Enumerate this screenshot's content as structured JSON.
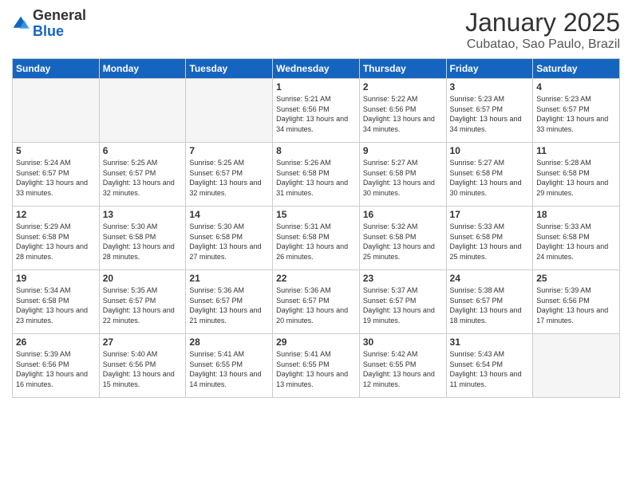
{
  "header": {
    "logo_general": "General",
    "logo_blue": "Blue",
    "month": "January 2025",
    "location": "Cubatao, Sao Paulo, Brazil"
  },
  "days_of_week": [
    "Sunday",
    "Monday",
    "Tuesday",
    "Wednesday",
    "Thursday",
    "Friday",
    "Saturday"
  ],
  "weeks": [
    [
      {
        "day": "",
        "sunrise": "",
        "sunset": "",
        "daylight": "",
        "empty": true
      },
      {
        "day": "",
        "sunrise": "",
        "sunset": "",
        "daylight": "",
        "empty": true
      },
      {
        "day": "",
        "sunrise": "",
        "sunset": "",
        "daylight": "",
        "empty": true
      },
      {
        "day": "1",
        "sunrise": "Sunrise: 5:21 AM",
        "sunset": "Sunset: 6:56 PM",
        "daylight": "Daylight: 13 hours and 34 minutes."
      },
      {
        "day": "2",
        "sunrise": "Sunrise: 5:22 AM",
        "sunset": "Sunset: 6:56 PM",
        "daylight": "Daylight: 13 hours and 34 minutes."
      },
      {
        "day": "3",
        "sunrise": "Sunrise: 5:23 AM",
        "sunset": "Sunset: 6:57 PM",
        "daylight": "Daylight: 13 hours and 34 minutes."
      },
      {
        "day": "4",
        "sunrise": "Sunrise: 5:23 AM",
        "sunset": "Sunset: 6:57 PM",
        "daylight": "Daylight: 13 hours and 33 minutes."
      }
    ],
    [
      {
        "day": "5",
        "sunrise": "Sunrise: 5:24 AM",
        "sunset": "Sunset: 6:57 PM",
        "daylight": "Daylight: 13 hours and 33 minutes."
      },
      {
        "day": "6",
        "sunrise": "Sunrise: 5:25 AM",
        "sunset": "Sunset: 6:57 PM",
        "daylight": "Daylight: 13 hours and 32 minutes."
      },
      {
        "day": "7",
        "sunrise": "Sunrise: 5:25 AM",
        "sunset": "Sunset: 6:57 PM",
        "daylight": "Daylight: 13 hours and 32 minutes."
      },
      {
        "day": "8",
        "sunrise": "Sunrise: 5:26 AM",
        "sunset": "Sunset: 6:58 PM",
        "daylight": "Daylight: 13 hours and 31 minutes."
      },
      {
        "day": "9",
        "sunrise": "Sunrise: 5:27 AM",
        "sunset": "Sunset: 6:58 PM",
        "daylight": "Daylight: 13 hours and 30 minutes."
      },
      {
        "day": "10",
        "sunrise": "Sunrise: 5:27 AM",
        "sunset": "Sunset: 6:58 PM",
        "daylight": "Daylight: 13 hours and 30 minutes."
      },
      {
        "day": "11",
        "sunrise": "Sunrise: 5:28 AM",
        "sunset": "Sunset: 6:58 PM",
        "daylight": "Daylight: 13 hours and 29 minutes."
      }
    ],
    [
      {
        "day": "12",
        "sunrise": "Sunrise: 5:29 AM",
        "sunset": "Sunset: 6:58 PM",
        "daylight": "Daylight: 13 hours and 28 minutes."
      },
      {
        "day": "13",
        "sunrise": "Sunrise: 5:30 AM",
        "sunset": "Sunset: 6:58 PM",
        "daylight": "Daylight: 13 hours and 28 minutes."
      },
      {
        "day": "14",
        "sunrise": "Sunrise: 5:30 AM",
        "sunset": "Sunset: 6:58 PM",
        "daylight": "Daylight: 13 hours and 27 minutes."
      },
      {
        "day": "15",
        "sunrise": "Sunrise: 5:31 AM",
        "sunset": "Sunset: 6:58 PM",
        "daylight": "Daylight: 13 hours and 26 minutes."
      },
      {
        "day": "16",
        "sunrise": "Sunrise: 5:32 AM",
        "sunset": "Sunset: 6:58 PM",
        "daylight": "Daylight: 13 hours and 25 minutes."
      },
      {
        "day": "17",
        "sunrise": "Sunrise: 5:33 AM",
        "sunset": "Sunset: 6:58 PM",
        "daylight": "Daylight: 13 hours and 25 minutes."
      },
      {
        "day": "18",
        "sunrise": "Sunrise: 5:33 AM",
        "sunset": "Sunset: 6:58 PM",
        "daylight": "Daylight: 13 hours and 24 minutes."
      }
    ],
    [
      {
        "day": "19",
        "sunrise": "Sunrise: 5:34 AM",
        "sunset": "Sunset: 6:58 PM",
        "daylight": "Daylight: 13 hours and 23 minutes."
      },
      {
        "day": "20",
        "sunrise": "Sunrise: 5:35 AM",
        "sunset": "Sunset: 6:57 PM",
        "daylight": "Daylight: 13 hours and 22 minutes."
      },
      {
        "day": "21",
        "sunrise": "Sunrise: 5:36 AM",
        "sunset": "Sunset: 6:57 PM",
        "daylight": "Daylight: 13 hours and 21 minutes."
      },
      {
        "day": "22",
        "sunrise": "Sunrise: 5:36 AM",
        "sunset": "Sunset: 6:57 PM",
        "daylight": "Daylight: 13 hours and 20 minutes."
      },
      {
        "day": "23",
        "sunrise": "Sunrise: 5:37 AM",
        "sunset": "Sunset: 6:57 PM",
        "daylight": "Daylight: 13 hours and 19 minutes."
      },
      {
        "day": "24",
        "sunrise": "Sunrise: 5:38 AM",
        "sunset": "Sunset: 6:57 PM",
        "daylight": "Daylight: 13 hours and 18 minutes."
      },
      {
        "day": "25",
        "sunrise": "Sunrise: 5:39 AM",
        "sunset": "Sunset: 6:56 PM",
        "daylight": "Daylight: 13 hours and 17 minutes."
      }
    ],
    [
      {
        "day": "26",
        "sunrise": "Sunrise: 5:39 AM",
        "sunset": "Sunset: 6:56 PM",
        "daylight": "Daylight: 13 hours and 16 minutes."
      },
      {
        "day": "27",
        "sunrise": "Sunrise: 5:40 AM",
        "sunset": "Sunset: 6:56 PM",
        "daylight": "Daylight: 13 hours and 15 minutes."
      },
      {
        "day": "28",
        "sunrise": "Sunrise: 5:41 AM",
        "sunset": "Sunset: 6:55 PM",
        "daylight": "Daylight: 13 hours and 14 minutes."
      },
      {
        "day": "29",
        "sunrise": "Sunrise: 5:41 AM",
        "sunset": "Sunset: 6:55 PM",
        "daylight": "Daylight: 13 hours and 13 minutes."
      },
      {
        "day": "30",
        "sunrise": "Sunrise: 5:42 AM",
        "sunset": "Sunset: 6:55 PM",
        "daylight": "Daylight: 13 hours and 12 minutes."
      },
      {
        "day": "31",
        "sunrise": "Sunrise: 5:43 AM",
        "sunset": "Sunset: 6:54 PM",
        "daylight": "Daylight: 13 hours and 11 minutes."
      },
      {
        "day": "",
        "sunrise": "",
        "sunset": "",
        "daylight": "",
        "empty": true
      }
    ]
  ]
}
